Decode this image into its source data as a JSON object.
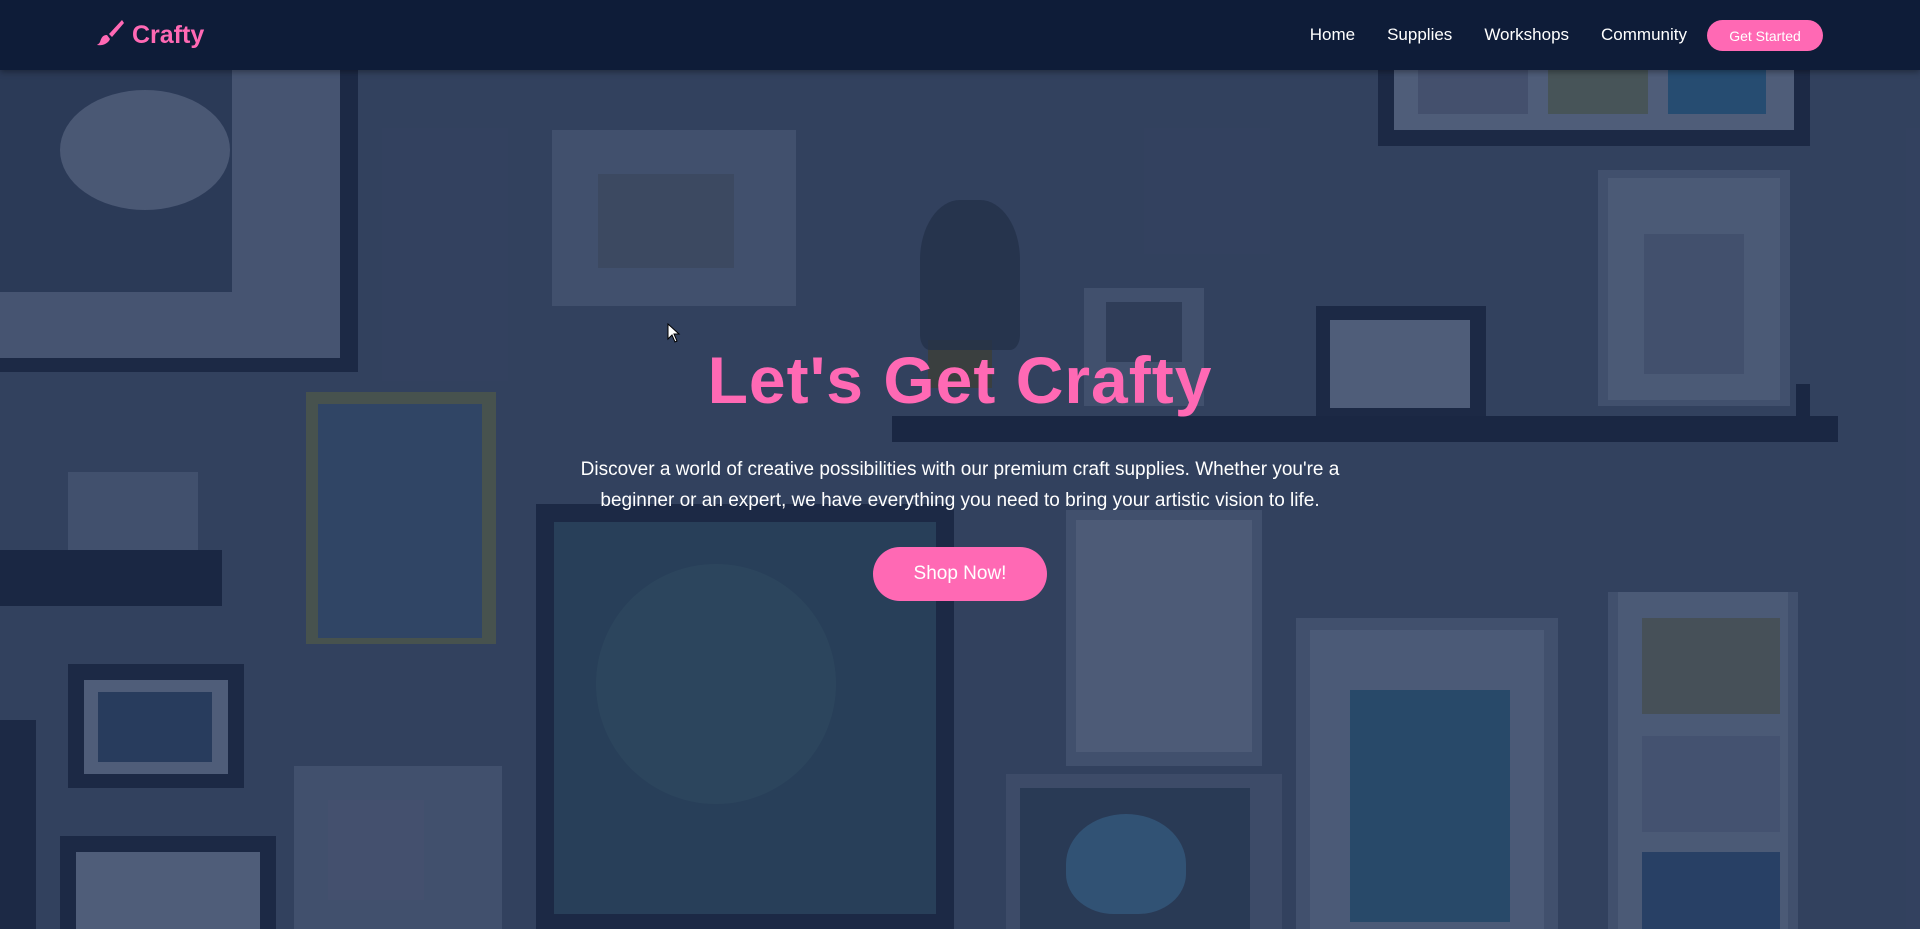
{
  "nav": {
    "brand": "Crafty",
    "brand_icon": "paintbrush-icon",
    "links": [
      {
        "label": "Home"
      },
      {
        "label": "Supplies"
      },
      {
        "label": "Workshops"
      },
      {
        "label": "Community"
      }
    ],
    "cta_label": "Get Started"
  },
  "hero": {
    "title": "Let's Get Crafty",
    "description": "Discover a world of creative possibilities with our premium craft supplies. Whether you're a beginner or an expert, we have everything you need to bring your artistic vision to life.",
    "button_label": "Shop Now!"
  },
  "colors": {
    "accent": "#ff69b4",
    "navbar": "#0e1c38",
    "text": "#ffffff"
  }
}
